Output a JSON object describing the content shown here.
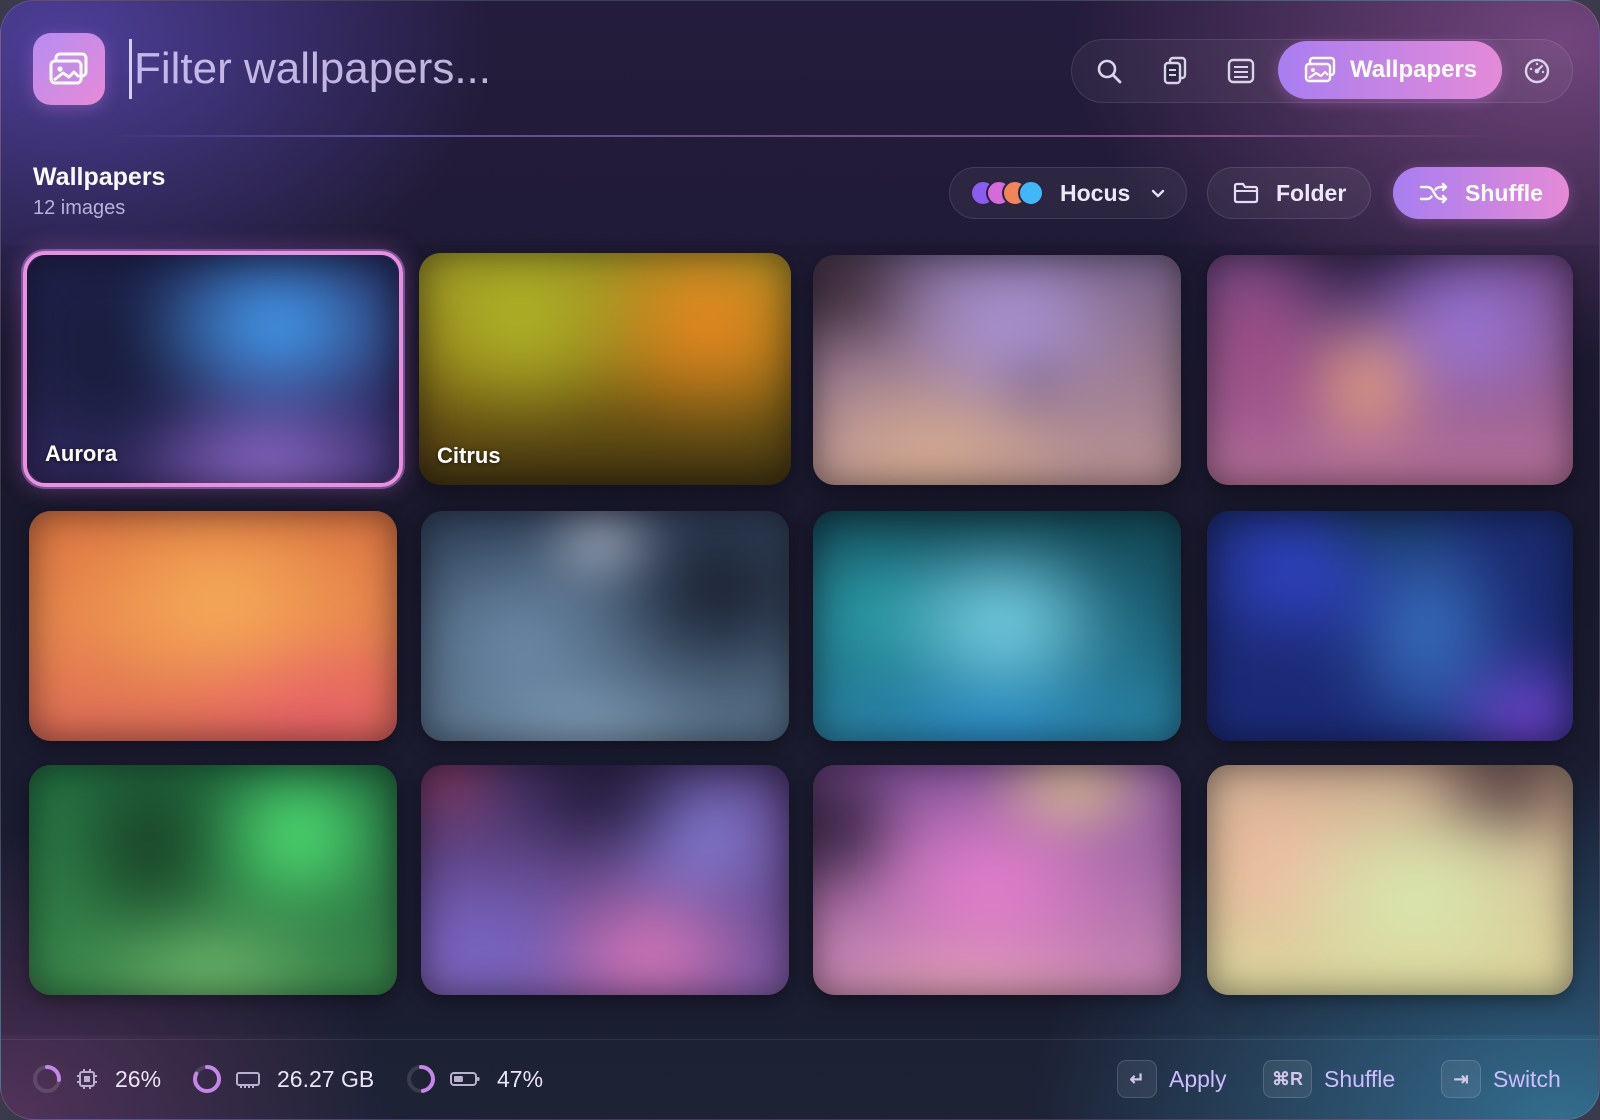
{
  "search": {
    "placeholder": "Filter wallpapers..."
  },
  "toolbar": {
    "active_tab_label": "Wallpapers"
  },
  "section": {
    "title": "Wallpapers",
    "count": "12 images"
  },
  "theme": {
    "label": "Hocus",
    "dot_colors": [
      "#8a5cf0",
      "#d46bd8",
      "#f2845c",
      "#3fb8f5"
    ]
  },
  "buttons": {
    "folder": "Folder",
    "shuffle": "Shuffle"
  },
  "wallpapers": [
    {
      "label": "Aurora",
      "selected": true
    },
    {
      "label": "Citrus",
      "selected": false
    },
    {
      "label": "",
      "selected": false
    },
    {
      "label": "",
      "selected": false
    },
    {
      "label": "",
      "selected": false
    },
    {
      "label": "",
      "selected": false
    },
    {
      "label": "",
      "selected": false
    },
    {
      "label": "",
      "selected": false
    },
    {
      "label": "",
      "selected": false
    },
    {
      "label": "",
      "selected": false
    },
    {
      "label": "",
      "selected": false
    },
    {
      "label": "",
      "selected": false
    }
  ],
  "footer": {
    "cpu": "26%",
    "cpu_fraction": 0.26,
    "memory": "26.27 GB",
    "memory_fraction": 0.82,
    "battery": "47%",
    "battery_fraction": 0.47,
    "hints": [
      {
        "key": "↵",
        "label": "Apply"
      },
      {
        "key": "⌘R",
        "label": "Shuffle"
      },
      {
        "key": "⇥",
        "label": "Switch"
      }
    ]
  },
  "colors": {
    "accent_start": "#a87ef0",
    "accent_end": "#e48ad8",
    "selected_border": "#ec8fdc"
  }
}
